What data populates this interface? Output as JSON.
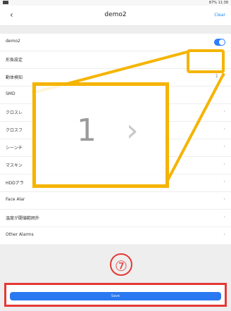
{
  "status": {
    "right": "     87% 11:38"
  },
  "nav": {
    "back": "‹",
    "title": "demo2",
    "clear": "Clear"
  },
  "rows": [
    {
      "label": "demo2",
      "type": "toggle"
    },
    {
      "label": "形負設定",
      "type": "section"
    },
    {
      "label": "動体検知",
      "value": "1",
      "type": "value"
    },
    {
      "label": "SMD",
      "type": "section"
    },
    {
      "label": "クロスレ",
      "type": "chevron"
    },
    {
      "label": "クロスフ",
      "type": "chevron"
    },
    {
      "label": "シーンチ",
      "type": "chevron"
    },
    {
      "label": "マスキン",
      "type": "chevron"
    },
    {
      "label": "HDDアラ",
      "type": "chevron"
    },
    {
      "label": "Face Alar",
      "type": "chevron"
    },
    {
      "label": "温度が閾値範囲外",
      "type": "chevron"
    },
    {
      "label": "Other Alarms",
      "type": "chevron"
    }
  ],
  "zoom": {
    "value": "1",
    "chevron": "›"
  },
  "marker": "⑦",
  "save": {
    "label": "Save"
  },
  "colors": {
    "accent": "#2a79f0",
    "highlight": "#f5b400",
    "danger": "#e53935"
  }
}
